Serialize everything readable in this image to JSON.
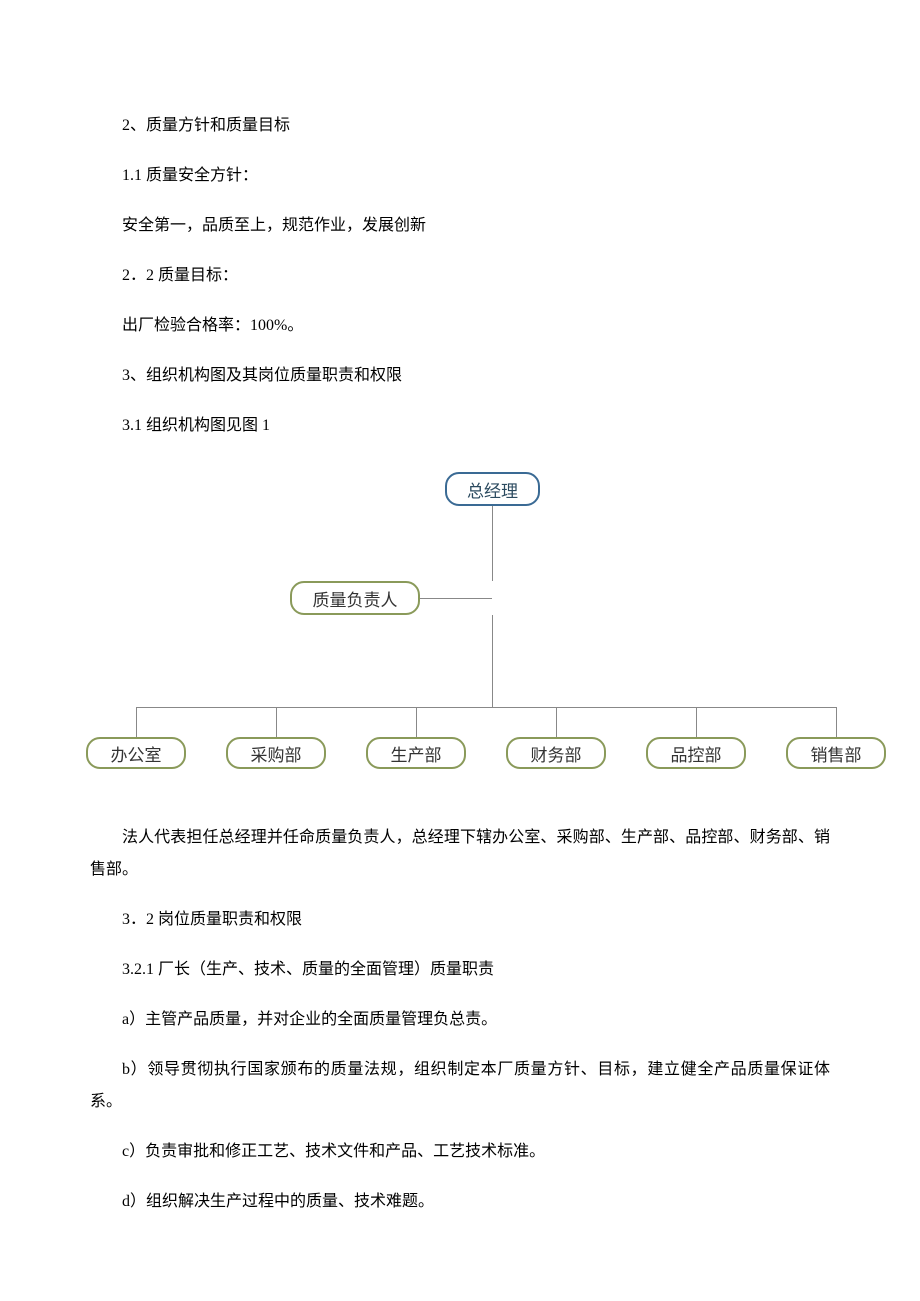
{
  "body": {
    "p1": "2、质量方针和质量目标",
    "p2": "1.1  质量安全方针：",
    "p3": "安全第一，品质至上，规范作业，发展创新",
    "p4": "2．2 质量目标：",
    "p5": "出厂检验合格率：100%。",
    "p6": "3、组织机构图及其岗位质量职责和权限",
    "p7": "3.1 组织机构图见图 1",
    "p8": "法人代表担任总经理并任命质量负责人，总经理下辖办公室、采购部、生产部、品控部、财务部、销售部。",
    "p9": "3．2 岗位质量职责和权限",
    "p10": "3.2.1 厂长（生产、技术、质量的全面管理）质量职责",
    "p11": "a）主管产品质量，并对企业的全面质量管理负总责。",
    "p12": "b）领导贯彻执行国家颁布的质量法规，组织制定本厂质量方针、目标，建立健全产品质量保证体系。",
    "p13": "c）负责审批和修正工艺、技术文件和产品、工艺技术标准。",
    "p14": "d）组织解决生产过程中的质量、技术难题。"
  },
  "org": {
    "top": "总经理",
    "mid": "质量负责人",
    "leaves": [
      "办公室",
      "采购部",
      "生产部",
      "财务部",
      "品控部",
      "销售部"
    ]
  }
}
